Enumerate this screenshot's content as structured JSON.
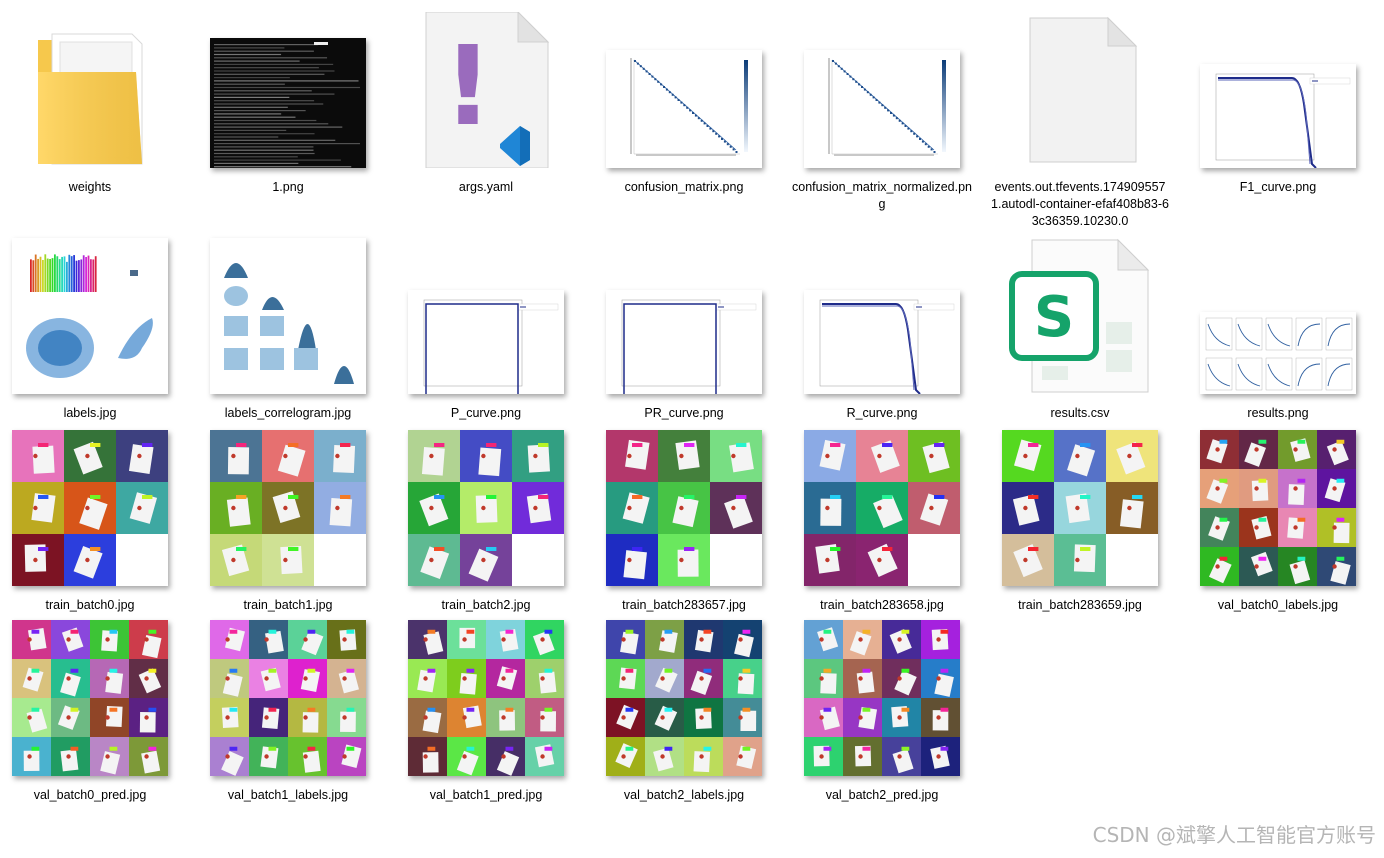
{
  "files": [
    {
      "name": "weights",
      "kind": "folder",
      "col": 0,
      "row": 0
    },
    {
      "name": "1.png",
      "kind": "terminal",
      "col": 1,
      "row": 0
    },
    {
      "name": "args.yaml",
      "kind": "yaml",
      "col": 2,
      "row": 0
    },
    {
      "name": "confusion_matrix.png",
      "kind": "confusion",
      "col": 3,
      "row": 0
    },
    {
      "name": "confusion_matrix_normalized.png",
      "kind": "confusion",
      "col": 4,
      "row": 0
    },
    {
      "name": "events.out.tfevents.1749095571.autodl-container-efaf408b83-63c36359.10230.0",
      "kind": "blank",
      "col": 5,
      "row": 0
    },
    {
      "name": "F1_curve.png",
      "kind": "curve_drop",
      "col": 6,
      "row": 0
    },
    {
      "name": "labels.jpg",
      "kind": "labels",
      "col": 0,
      "row": 1
    },
    {
      "name": "labels_correlogram.jpg",
      "kind": "correlogram",
      "col": 1,
      "row": 1
    },
    {
      "name": "P_curve.png",
      "kind": "curve_flat",
      "col": 2,
      "row": 1
    },
    {
      "name": "PR_curve.png",
      "kind": "curve_flat",
      "col": 3,
      "row": 1
    },
    {
      "name": "R_curve.png",
      "kind": "curve_drop",
      "col": 4,
      "row": 1
    },
    {
      "name": "results.csv",
      "kind": "sheet",
      "col": 5,
      "row": 1
    },
    {
      "name": "results.png",
      "kind": "results",
      "col": 6,
      "row": 1
    },
    {
      "name": "train_batch0.jpg",
      "kind": "batch3",
      "col": 0,
      "row": 2
    },
    {
      "name": "train_batch1.jpg",
      "kind": "batch3",
      "col": 1,
      "row": 2
    },
    {
      "name": "train_batch2.jpg",
      "kind": "batch3",
      "col": 2,
      "row": 2
    },
    {
      "name": "train_batch283657.jpg",
      "kind": "batch3",
      "col": 3,
      "row": 2
    },
    {
      "name": "train_batch283658.jpg",
      "kind": "batch3",
      "col": 4,
      "row": 2
    },
    {
      "name": "train_batch283659.jpg",
      "kind": "batch3",
      "col": 5,
      "row": 2
    },
    {
      "name": "val_batch0_labels.jpg",
      "kind": "batch4",
      "col": 6,
      "row": 2
    },
    {
      "name": "val_batch0_pred.jpg",
      "kind": "batch4",
      "col": 0,
      "row": 3
    },
    {
      "name": "val_batch1_labels.jpg",
      "kind": "batch4",
      "col": 1,
      "row": 3
    },
    {
      "name": "val_batch1_pred.jpg",
      "kind": "batch4",
      "col": 2,
      "row": 3
    },
    {
      "name": "val_batch2_labels.jpg",
      "kind": "batch4",
      "col": 3,
      "row": 3
    },
    {
      "name": "val_batch2_pred.jpg",
      "kind": "batch4",
      "col": 4,
      "row": 3
    }
  ],
  "icons": {
    "folder": "folder-icon",
    "yaml": "vscode-yaml-icon",
    "sheet": "wps-spreadsheet-icon",
    "blank": "blank-file-icon"
  },
  "glyphs": {
    "yaml": "!",
    "sheet": "S"
  },
  "colors": {
    "folder": "#f6c84c",
    "yaml_mark": "#9a6bbd",
    "vscode": "#1f86d6",
    "sheet": "#15a36a",
    "line": "#1f2c8a"
  },
  "watermark": "CSDN @斌擎人工智能官方账号"
}
